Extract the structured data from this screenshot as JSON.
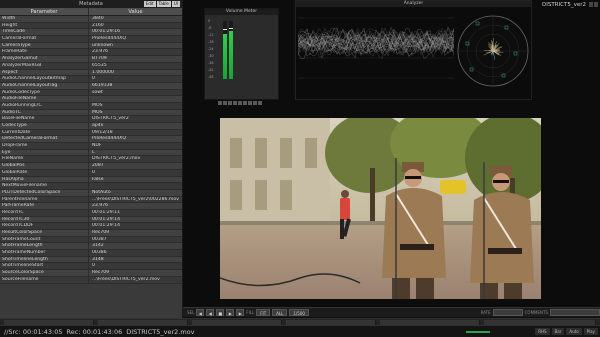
{
  "metadata": {
    "title": "Metadata",
    "title_buttons": [
      "Edit",
      "Table",
      "UI"
    ],
    "col_param": "Parameter",
    "col_value": "Value",
    "rows": [
      {
        "k": "Width",
        "v": "3840"
      },
      {
        "k": "Height",
        "v": "2160"
      },
      {
        "k": "TimeCode",
        "v": "00:01:29:16"
      },
      {
        "k": "CameraFormat",
        "v": "ProRes4444XQ"
      },
      {
        "k": "CameraType",
        "v": "unknown"
      },
      {
        "k": "FrameRate",
        "v": "23.976"
      },
      {
        "k": "AnalyzerGamut",
        "v": "BT709"
      },
      {
        "k": "AnalyzerMaxRGB",
        "v": "65535"
      },
      {
        "k": "Aspect",
        "v": "1.000000"
      },
      {
        "k": "AudioChannelLayoutBitmap",
        "v": "0"
      },
      {
        "k": "AudioChannelLayoutTag",
        "v": "6619138"
      },
      {
        "k": "AudioCodecType",
        "v": "sowt"
      },
      {
        "k": "AudioFileName",
        "v": ""
      },
      {
        "k": "AudioRunningLTC",
        "v": "MOS"
      },
      {
        "k": "AudioTC",
        "v": "MOS"
      },
      {
        "k": "BaseFileName",
        "v": "DISTRICT5_ver2"
      },
      {
        "k": "CodecType",
        "v": "ap4x"
      },
      {
        "k": "CurrentDate",
        "v": "09/12/18"
      },
      {
        "k": "DetectedCameraFormat",
        "v": "ProRes4444XQ"
      },
      {
        "k": "DropFrame",
        "v": "NDF"
      },
      {
        "k": "Eye",
        "v": "L"
      },
      {
        "k": "FileName",
        "v": "DISTRICT5_ver2.mov"
      },
      {
        "k": "GlobalPos",
        "v": "2087"
      },
      {
        "k": "GlobalRate",
        "v": "0"
      },
      {
        "k": "HasAlpha",
        "v": "False"
      },
      {
        "k": "NextMovieFilename",
        "v": ""
      },
      {
        "k": "PLUTDetectedColorSpace",
        "v": "NotAuto"
      },
      {
        "k": "ParentFilename",
        "v": "...\\Frees\\DISTRICT5_ver2\\002286.mov"
      },
      {
        "k": "ParFrameRate",
        "v": "23.976"
      },
      {
        "k": "RecordTC",
        "v": "00:01:29:11"
      },
      {
        "k": "RecordTC30",
        "v": "00:01:29:14"
      },
      {
        "k": "RecordTCDDF",
        "v": "00:01:29:14"
      },
      {
        "k": "ResultColorSpace",
        "v": "Rec709"
      },
      {
        "k": "ShotFrameCount",
        "v": "00387"
      },
      {
        "k": "ShotFrameLength",
        "v": "3142"
      },
      {
        "k": "ShotFrameNumber",
        "v": "00386"
      },
      {
        "k": "ShotTimelineLength",
        "v": "3148"
      },
      {
        "k": "ShotTimelineStart",
        "v": "0"
      },
      {
        "k": "SourceColorSpace",
        "v": "Rec709"
      },
      {
        "k": "SourceFilename",
        "v": "...\\Frees\\DISTRICT5_ver2.mov"
      }
    ]
  },
  "volume": {
    "title": "Volume Meter",
    "scale": [
      "0",
      "-6",
      "-12",
      "-18",
      "-24",
      "-30",
      "-36",
      "-42",
      "-48"
    ],
    "levels": [
      0.78,
      0.82
    ],
    "peaks": [
      0.84,
      0.86
    ]
  },
  "analyzer": {
    "title": "Analyzer"
  },
  "clip_label": "DISTRICT5_ver2",
  "transport": {
    "label_sel": "SEL",
    "label_fill": "FILL",
    "btn_fit": "FIT",
    "btn_all": "ALL",
    "btn_500": "1/500",
    "label_rate": "RATE",
    "label_comments": "COMMENTS"
  },
  "status": {
    "src": "//Src:  00:01:43:05",
    "rec": "Rec:  00:01:43:06",
    "file": "DISTRICT5_ver2.mov",
    "right_buttons": [
      "RHS",
      "Bar",
      "Auto",
      "Play"
    ]
  },
  "colors": {
    "meter_green": "#2fcf4c",
    "panel_bg": "#3a3a3a"
  }
}
